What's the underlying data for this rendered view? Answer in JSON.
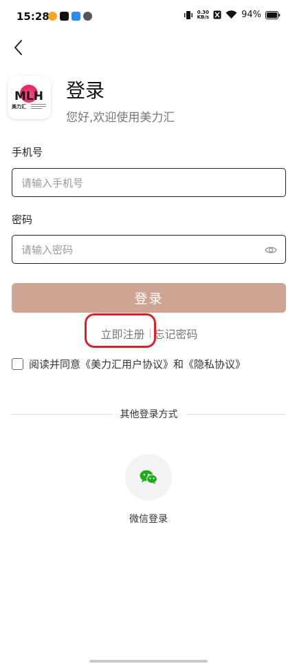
{
  "status_bar": {
    "time": "15:28",
    "net_speed_value": "0.30",
    "net_speed_unit": "KB/s",
    "battery": "94%"
  },
  "header": {
    "logo_text": "MLH",
    "logo_sub": "美力汇",
    "title": "登录",
    "subtitle": "您好,欢迎使用美力汇"
  },
  "form": {
    "phone_label": "手机号",
    "phone_placeholder": "请输入手机号",
    "phone_value": "",
    "password_label": "密码",
    "password_placeholder": "请输入密码",
    "password_value": "",
    "login_button": "登录"
  },
  "links": {
    "register": "立即注册",
    "forgot": "忘记密码"
  },
  "agreement": {
    "prefix": "阅读并同意",
    "user_agreement": "《美力汇用户协议》",
    "conjunction": "和",
    "privacy": "《隐私协议》",
    "checked": false
  },
  "other_login": {
    "divider_text": "其他登录方式",
    "wechat_label": "微信登录"
  },
  "colors": {
    "login_button": "#cda592",
    "highlight": "#e21e26",
    "wechat": "#1aad19"
  }
}
